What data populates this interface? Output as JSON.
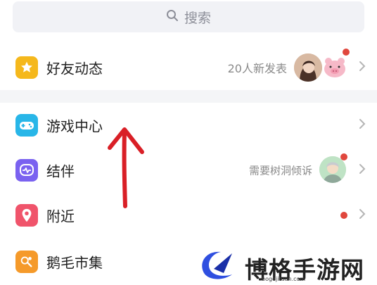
{
  "search": {
    "placeholder": "搜索"
  },
  "rows": [
    {
      "label": "好友动态",
      "right_text": "20人新发表"
    },
    {
      "label": "游戏中心"
    },
    {
      "label": "结伴",
      "right_text": "需要树洞倾诉"
    },
    {
      "label": "附近"
    },
    {
      "label": "鹅毛市集"
    }
  ],
  "watermark": {
    "brand": "博格手游网",
    "url": "bogejituan.com"
  },
  "colors": {
    "yellow": "#f5b81c",
    "cyan": "#28b6e8",
    "purple": "#7a62f0",
    "red": "#f0546b",
    "orange": "#f59a2a",
    "arrow": "#d91f26"
  }
}
